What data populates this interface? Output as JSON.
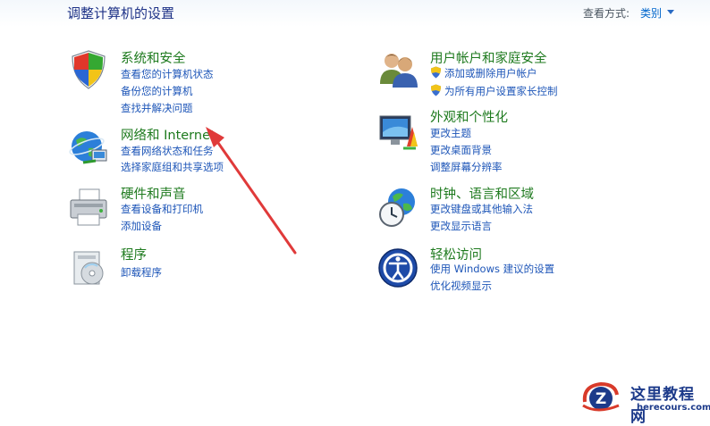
{
  "header": {
    "title": "调整计算机的设置",
    "view_by_label": "查看方式:",
    "view_by_value": "类别"
  },
  "categories": {
    "system_security": {
      "title": "系统和安全",
      "links": [
        "查看您的计算机状态",
        "备份您的计算机",
        "查找并解决问题"
      ]
    },
    "network": {
      "title": "网络和 Internet",
      "links": [
        "查看网络状态和任务",
        "选择家庭组和共享选项"
      ]
    },
    "hardware": {
      "title": "硬件和声音",
      "links": [
        "查看设备和打印机",
        "添加设备"
      ]
    },
    "programs": {
      "title": "程序",
      "links": [
        "卸载程序"
      ]
    },
    "users": {
      "title": "用户帐户和家庭安全",
      "links": [
        "添加或删除用户帐户",
        "为所有用户设置家长控制"
      ]
    },
    "appearance": {
      "title": "外观和个性化",
      "links": [
        "更改主题",
        "更改桌面背景",
        "调整屏幕分辨率"
      ]
    },
    "clock": {
      "title": "时钟、语言和区域",
      "links": [
        "更改键盘或其他输入法",
        "更改显示语言"
      ]
    },
    "ease": {
      "title": "轻松访问",
      "links": [
        "使用 Windows 建议的设置",
        "优化视频显示"
      ]
    }
  },
  "watermark": {
    "site_name": "这里教程网",
    "site_domain": "herecours.com",
    "logo_letter": "Z"
  },
  "colors": {
    "title_green": "#1e7a1e",
    "link_blue": "#1e56b8",
    "arrow_red": "#e03a3a"
  }
}
